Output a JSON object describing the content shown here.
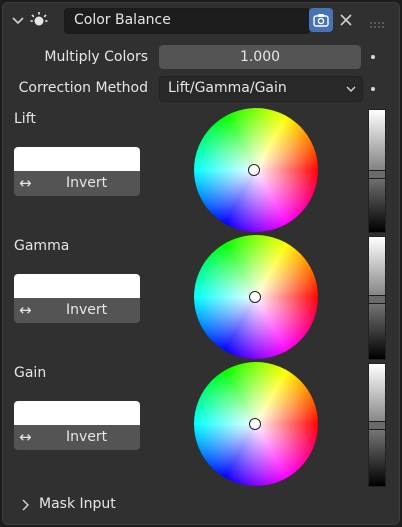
{
  "header": {
    "title": "Color Balance",
    "icons": {
      "collapse": "chevron-down-icon",
      "modifier": "color-balance-icon",
      "camera": "camera-icon",
      "close": "close-icon",
      "drag": "drag-handle-icon"
    }
  },
  "multiply": {
    "label": "Multiply Colors",
    "value": "1.000"
  },
  "correction": {
    "label": "Correction Method",
    "value": "Lift/Gamma/Gain"
  },
  "wheels": [
    {
      "label": "Lift",
      "invert_label": "Invert",
      "value_level": 0.47
    },
    {
      "label": "Gamma",
      "invert_label": "Invert",
      "value_level": 0.49
    },
    {
      "label": "Gain",
      "invert_label": "Invert",
      "value_level": 0.5
    }
  ],
  "mask": {
    "label": "Mask Input"
  },
  "colors": {
    "accent": "#4772b3",
    "panel": "#303030",
    "field": "#545454"
  }
}
